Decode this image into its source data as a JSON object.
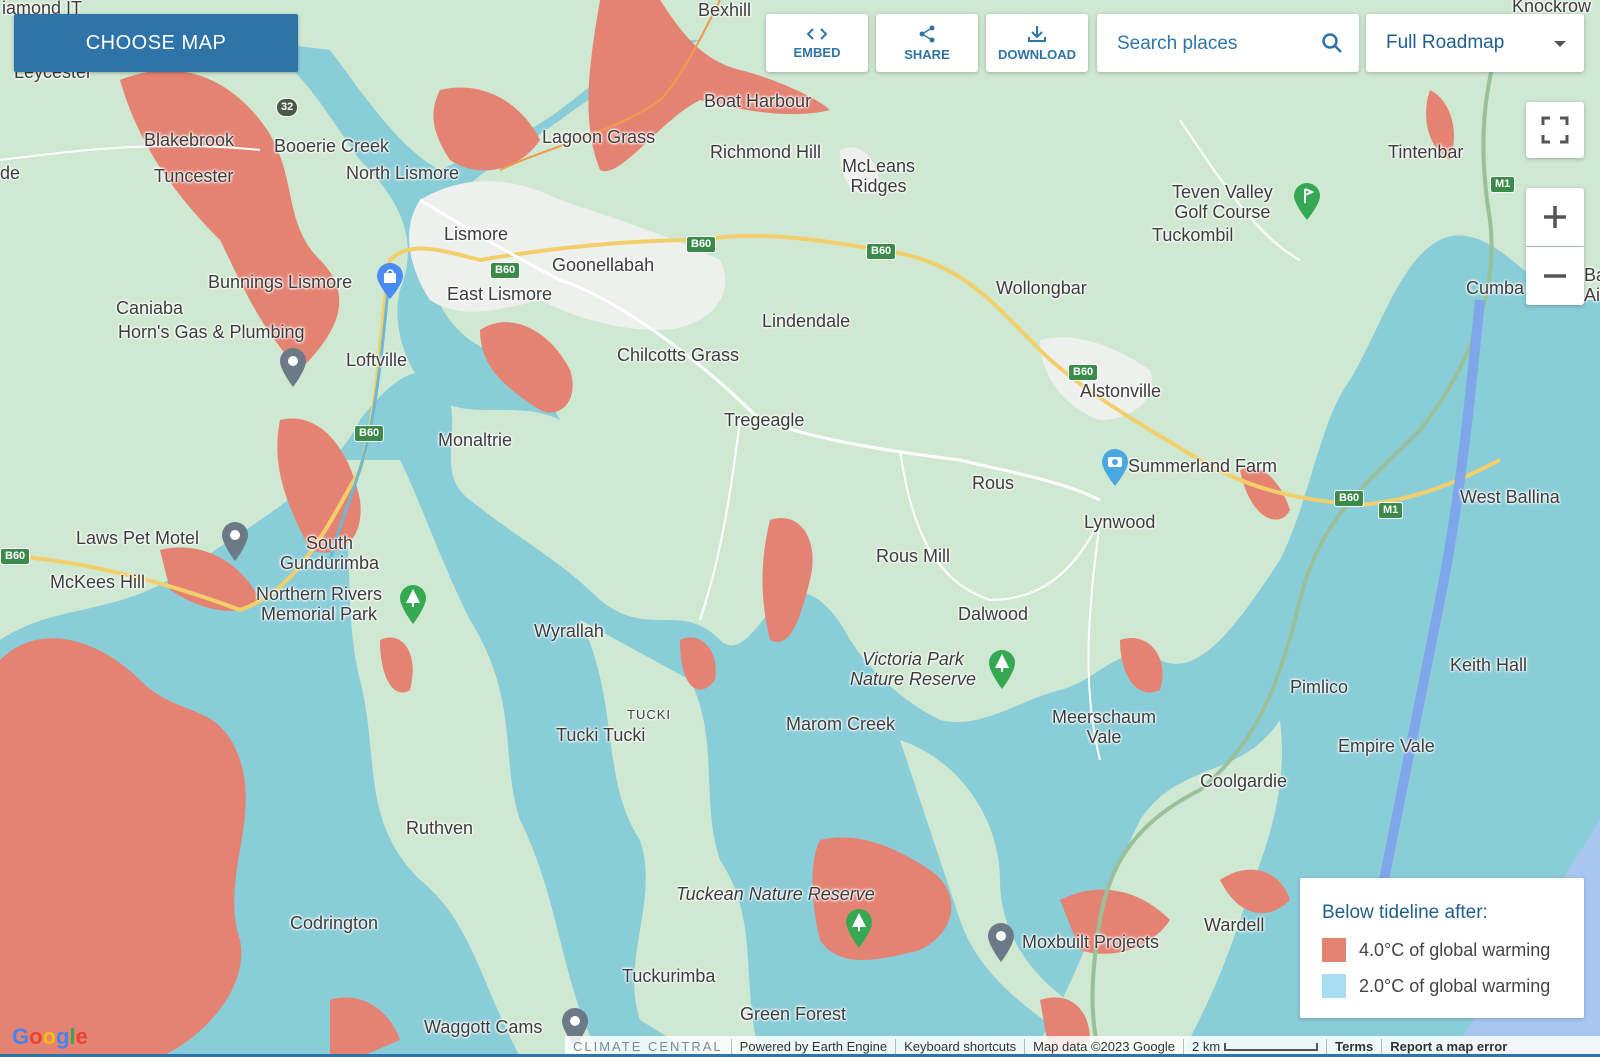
{
  "toolbar": {
    "choose_map": "CHOOSE MAP",
    "embed": "EMBED",
    "share": "SHARE",
    "download": "DOWNLOAD",
    "search_placeholder": "Search places",
    "map_type": "Full Roadmap"
  },
  "legend": {
    "title": "Below tideline after:",
    "items": [
      {
        "label": "4.0°C of global warming",
        "color": "#e58373"
      },
      {
        "label": "2.0°C of global warming",
        "color": "#a8dcf0"
      }
    ]
  },
  "colors": {
    "land": "#cfe8d2",
    "water_2c": "#89cdd8",
    "flood_4c": "#e58373",
    "urban": "#eef0ee",
    "ocean": "#a7c7f0",
    "brand": "#2f74a8"
  },
  "places": {
    "bexhill": "Bexhill",
    "boat_harbour": "Boat Harbour",
    "leycester": "Leycester",
    "diamond": "iamond IT",
    "knockrow": "Knockrow",
    "blakebrook": "Blakebrook",
    "booerie_creek": "Booerie Creek",
    "lagoon_grass": "Lagoon Grass",
    "richmond_hill": "Richmond Hill",
    "mcleans_ridges": "McLeans\nRidges",
    "tintenbar": "Tintenbar",
    "de": "de",
    "tuncester": "Tuncester",
    "north_lismore": "North Lismore",
    "teven_valley": "Teven Valley\nGolf Course",
    "tuckombil": "Tuckombil",
    "lismore": "Lismore",
    "goonellabah": "Goonellabah",
    "wollongbar": "Wollongbar",
    "cumba": "Cumba",
    "ba": "Ba\nAi",
    "bunnings": "Bunnings Lismore",
    "east_lismore": "East Lismore",
    "caniaba": "Caniaba",
    "lindendale": "Lindendale",
    "horns_gas": "Horn's Gas & Plumbing",
    "loftville": "Loftville",
    "chilcotts_grass": "Chilcotts Grass",
    "alstonville": "Alstonville",
    "tregeagle": "Tregeagle",
    "monaltrie": "Monaltrie",
    "summerland": "Summerland Farm",
    "rous": "Rous",
    "west_ballina": "West Ballina",
    "lynwood": "Lynwood",
    "laws_pet": "Laws Pet Motel",
    "south_gundurimba": "South\nGundurimba",
    "rous_mill": "Rous Mill",
    "mckees_hill": "McKees Hill",
    "northern_rivers": "Northern Rivers\nMemorial Park",
    "dalwood": "Dalwood",
    "wyrallah": "Wyrallah",
    "victoria_park": "Victoria Park\nNature Reserve",
    "keith_hall": "Keith Hall",
    "pimlico": "Pimlico",
    "tucki_small": "TUCKI",
    "tucki_tucki": "Tucki Tucki",
    "marom_creek": "Marom Creek",
    "meerschaum_vale": "Meerschaum\nVale",
    "empire_vale": "Empire Vale",
    "coolgardie": "Coolgardie",
    "ruthven": "Ruthven",
    "tuckean": "Tuckean Nature Reserve",
    "codrington": "Codrington",
    "wardell": "Wardell",
    "moxbuilt": "Moxbuilt Projects",
    "tuckurimba": "Tuckurimba",
    "waggott": "Waggott Cams",
    "green_forest": "Green Forest"
  },
  "roads": {
    "b60": "B60",
    "m1": "M1",
    "r32": "32"
  },
  "attribution": {
    "climate_central": "CLIMATE CENTRAL",
    "powered_by": "Powered by Earth Engine",
    "keyboard": "Keyboard shortcuts",
    "map_data": "Map data ©2023 Google",
    "scale": "2 km",
    "terms": "Terms",
    "report": "Report a map error",
    "google": "Google"
  }
}
